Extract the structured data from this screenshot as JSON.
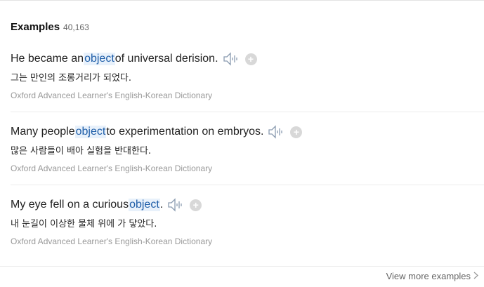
{
  "header": {
    "title": "Examples",
    "count": "40,163"
  },
  "examples": [
    {
      "pre": "He became an ",
      "keyword": "object",
      "post": " of universal derision.",
      "translation": "그는 만인의 조롱거리가 되었다.",
      "source": "Oxford Advanced Learner's English-Korean Dictionary"
    },
    {
      "pre": "Many people ",
      "keyword": "object",
      "post": " to experimentation on embryos.",
      "translation": "많은 사람들이 배아 실험을 반대한다.",
      "source": "Oxford Advanced Learner's English-Korean Dictionary"
    },
    {
      "pre": "My eye fell on a curious ",
      "keyword": "object",
      "post": ".",
      "translation": "내 눈길이 이상한 물체 위에 가 닿았다.",
      "source": "Oxford Advanced Learner's English-Korean Dictionary"
    }
  ],
  "footer": {
    "more_label": "View more examples"
  },
  "icons": {
    "speaker": "speaker-icon",
    "add": "plus-icon",
    "more": "chevron-right-icon"
  },
  "colors": {
    "highlight_bg": "#e8f1fb",
    "highlight_text": "#1f5ea8",
    "muted": "#999999"
  }
}
